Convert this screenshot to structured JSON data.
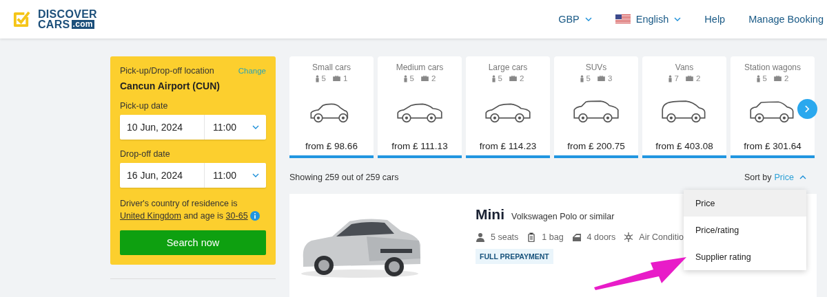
{
  "header": {
    "logo": {
      "line1": "DISCOVER",
      "line2": "CARS",
      "badge": ".com"
    },
    "nav": [
      {
        "kind": "dropdown",
        "label": "GBP"
      },
      {
        "kind": "language",
        "label": "English"
      },
      {
        "kind": "link",
        "label": "Help"
      },
      {
        "kind": "link",
        "label": "Manage Booking"
      }
    ]
  },
  "search_panel": {
    "location_label": "Pick-up/Drop-off location",
    "change_link": "Change",
    "location": "Cancun Airport (CUN)",
    "pickup_label": "Pick-up date",
    "pickup_date": "10 Jun, 2024",
    "pickup_time": "11:00",
    "dropoff_label": "Drop-off date",
    "dropoff_date": "16 Jun, 2024",
    "dropoff_time": "11:00",
    "residence_text": "Driver's country of residence is",
    "country": "United Kingdom",
    "age_text": "and age is",
    "age": "30-65",
    "button": "Search now"
  },
  "categories": [
    {
      "kind": "small",
      "name": "Small cars",
      "seats": "5",
      "bags": "1",
      "price": "from £ 98.66"
    },
    {
      "kind": "sedan",
      "name": "Medium cars",
      "seats": "5",
      "bags": "2",
      "price": "from £ 111.13"
    },
    {
      "kind": "sedan",
      "name": "Large cars",
      "seats": "5",
      "bags": "2",
      "price": "from £ 114.23"
    },
    {
      "kind": "suv",
      "name": "SUVs",
      "seats": "5",
      "bags": "3",
      "price": "from £ 200.75"
    },
    {
      "kind": "van",
      "name": "Vans",
      "seats": "7",
      "bags": "2",
      "price": "from £ 403.08"
    },
    {
      "kind": "wagon",
      "name": "Station wagons",
      "seats": "5",
      "bags": "2",
      "price": "from £ 301.64"
    }
  ],
  "results_summary": "Showing 259 out of 259 cars",
  "sort": {
    "label": "Sort by",
    "value": "Price",
    "expanded": true,
    "options": [
      {
        "label": "Price",
        "selected": true
      },
      {
        "label": "Price/rating",
        "selected": false
      },
      {
        "label": "Supplier rating",
        "selected": false
      }
    ]
  },
  "result": {
    "name": "Mini",
    "model": "Volkswagen Polo or similar",
    "features": [
      {
        "kind": "seats",
        "label": "5 seats"
      },
      {
        "kind": "bag",
        "label": "1 bag"
      },
      {
        "kind": "doors",
        "label": "4 doors"
      },
      {
        "kind": "ac",
        "label": "Air Conditio"
      }
    ],
    "badge": "FULL PREPAYMENT"
  }
}
